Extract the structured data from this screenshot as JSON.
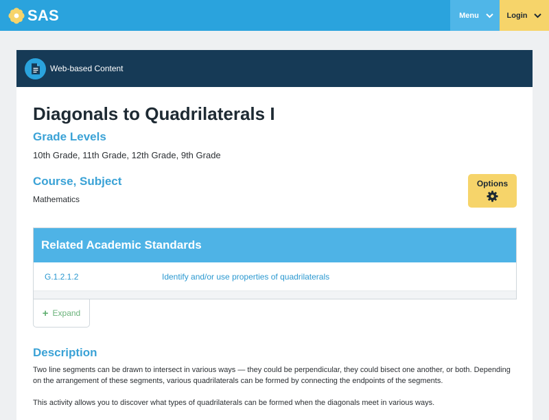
{
  "nav": {
    "brand": "SAS",
    "menu_label": "Menu",
    "login_label": "Login",
    "icons": {
      "brand": "sas-flower-logo",
      "menu_chevron": "chevron-down-icon",
      "login_chevron": "chevron-down-icon"
    }
  },
  "resource": {
    "type_label": "Web-based Content",
    "type_icon": "document-icon",
    "title": "Diagonals to Quadrilaterals I",
    "grade_heading": "Grade Levels",
    "grades": "10th Grade, 11th Grade, 12th Grade, 9th Grade",
    "course_heading": "Course, Subject",
    "course": "Mathematics",
    "options_label": "Options",
    "options_icon": "gear-icon"
  },
  "standards": {
    "heading": "Related Academic Standards",
    "rows": [
      {
        "code": "G.1.2.1.2",
        "description": "Identify and/or use properties of quadrilaterals"
      }
    ],
    "expand_label": "Expand"
  },
  "description": {
    "heading": "Description",
    "paragraphs": [
      "Two line segments can be drawn to intersect in various ways — they could be perpendicular, they could bisect one another, or both. Depending on the arrangement of these segments, various quadrilaterals can be formed by connecting the endpoints of the segments.",
      "This activity allows you to discover what types of quadrilaterals can be formed when the diagonals meet in various ways."
    ]
  },
  "colors": {
    "topbar": "#2aa3dd",
    "menu": "#4fb6e8",
    "login": "#f6d46a",
    "card_header": "#163a56",
    "accent_text": "#3aa2d6",
    "link": "#2a98d0",
    "expand_green": "#6ab27a"
  }
}
